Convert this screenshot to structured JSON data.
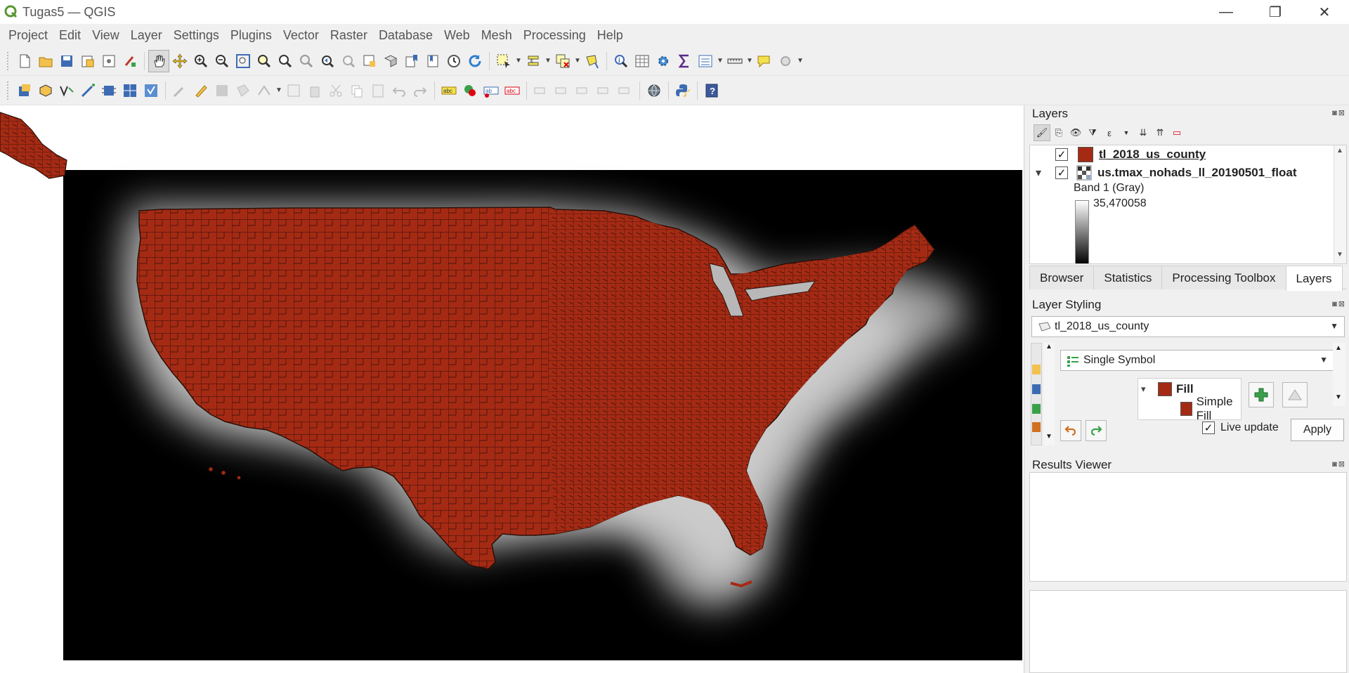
{
  "window": {
    "title": "Tugas5 — QGIS",
    "minimize": "—",
    "restore": "❐",
    "close": "✕"
  },
  "menu": [
    {
      "label": "Project",
      "u": "P",
      "rest": "roject"
    },
    {
      "label": "Edit",
      "u": "E",
      "rest": "dit"
    },
    {
      "label": "View",
      "u": "V",
      "rest": "iew"
    },
    {
      "label": "Layer",
      "u": "L",
      "rest": "ayer"
    },
    {
      "label": "Settings",
      "u": "S",
      "rest": "ettings"
    },
    {
      "label": "Plugins",
      "u": "P",
      "rest": "lugins"
    },
    {
      "label": "Vector",
      "u": "o",
      "pre": "Vect",
      "rest": "r"
    },
    {
      "label": "Raster",
      "u": "R",
      "rest": "aster"
    },
    {
      "label": "Database",
      "u": "D",
      "rest": "atabase"
    },
    {
      "label": "Web",
      "u": "W",
      "rest": "eb"
    },
    {
      "label": "Mesh",
      "u": "M",
      "rest": "esh"
    },
    {
      "label": "Processing",
      "u": "o",
      "pre": "Pr",
      "rest": "cessing"
    },
    {
      "label": "Help",
      "u": "H",
      "rest": "elp"
    }
  ],
  "layers_panel": {
    "title": "Layers",
    "layers": [
      {
        "name": "tl_2018_us_county",
        "checked": "✓",
        "selected": true
      },
      {
        "name": "us.tmax_nohads_ll_20190501_float",
        "checked": "✓",
        "expanded": "▾"
      }
    ],
    "band_label": "Band 1 (Gray)",
    "band_value": "35,470058"
  },
  "tabs": [
    "Browser",
    "Statistics",
    "Processing Toolbox",
    "Layers"
  ],
  "active_tab": "Layers",
  "layer_styling": {
    "title": "Layer Styling",
    "layer": "tl_2018_us_county",
    "renderer": "Single Symbol",
    "symbol_root": "Fill",
    "symbol_child": "Simple Fill",
    "live_update_label": "Live update",
    "live_update_checked": "✓",
    "apply_label": "Apply"
  },
  "results_viewer": {
    "title": "Results Viewer"
  },
  "colors": {
    "county_fill": "#a52a14",
    "county_stroke": "#2b0f08",
    "raster_background": "#000000",
    "accent_green": "#3aa14a"
  }
}
